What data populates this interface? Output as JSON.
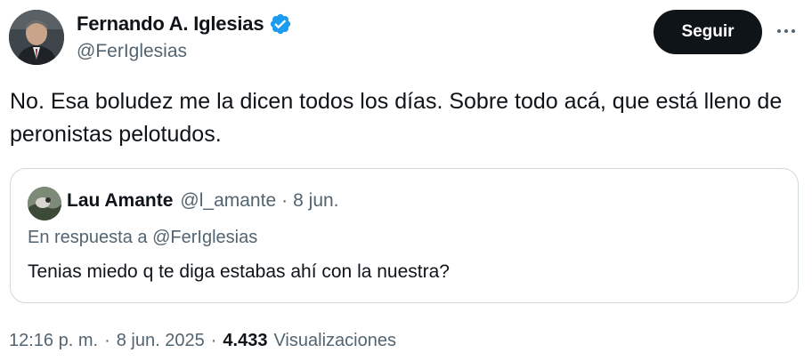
{
  "author": {
    "display_name": "Fernando A. Iglesias",
    "handle": "@FerIglesias",
    "verified": true,
    "verified_color": "#1d9bf0"
  },
  "actions": {
    "follow_label": "Seguir",
    "more_icon": "more-horizontal-icon"
  },
  "tweet": {
    "text": "No. Esa boludez me la dicen todos los días. Sobre todo acá, que está lleno de peronistas pelotudos."
  },
  "quoted_tweet": {
    "display_name": "Lau Amante",
    "handle": "@l_amante",
    "separator": "·",
    "date": "8 jun.",
    "reply_to": "En respuesta a @FerIglesias",
    "text": "Tenias miedo q te diga estabas ahí con la nuestra?"
  },
  "meta": {
    "time": "12:16 p. m.",
    "separator": "·",
    "date": "8 jun. 2025",
    "views_count": "4.433",
    "views_label": "Visualizaciones"
  }
}
